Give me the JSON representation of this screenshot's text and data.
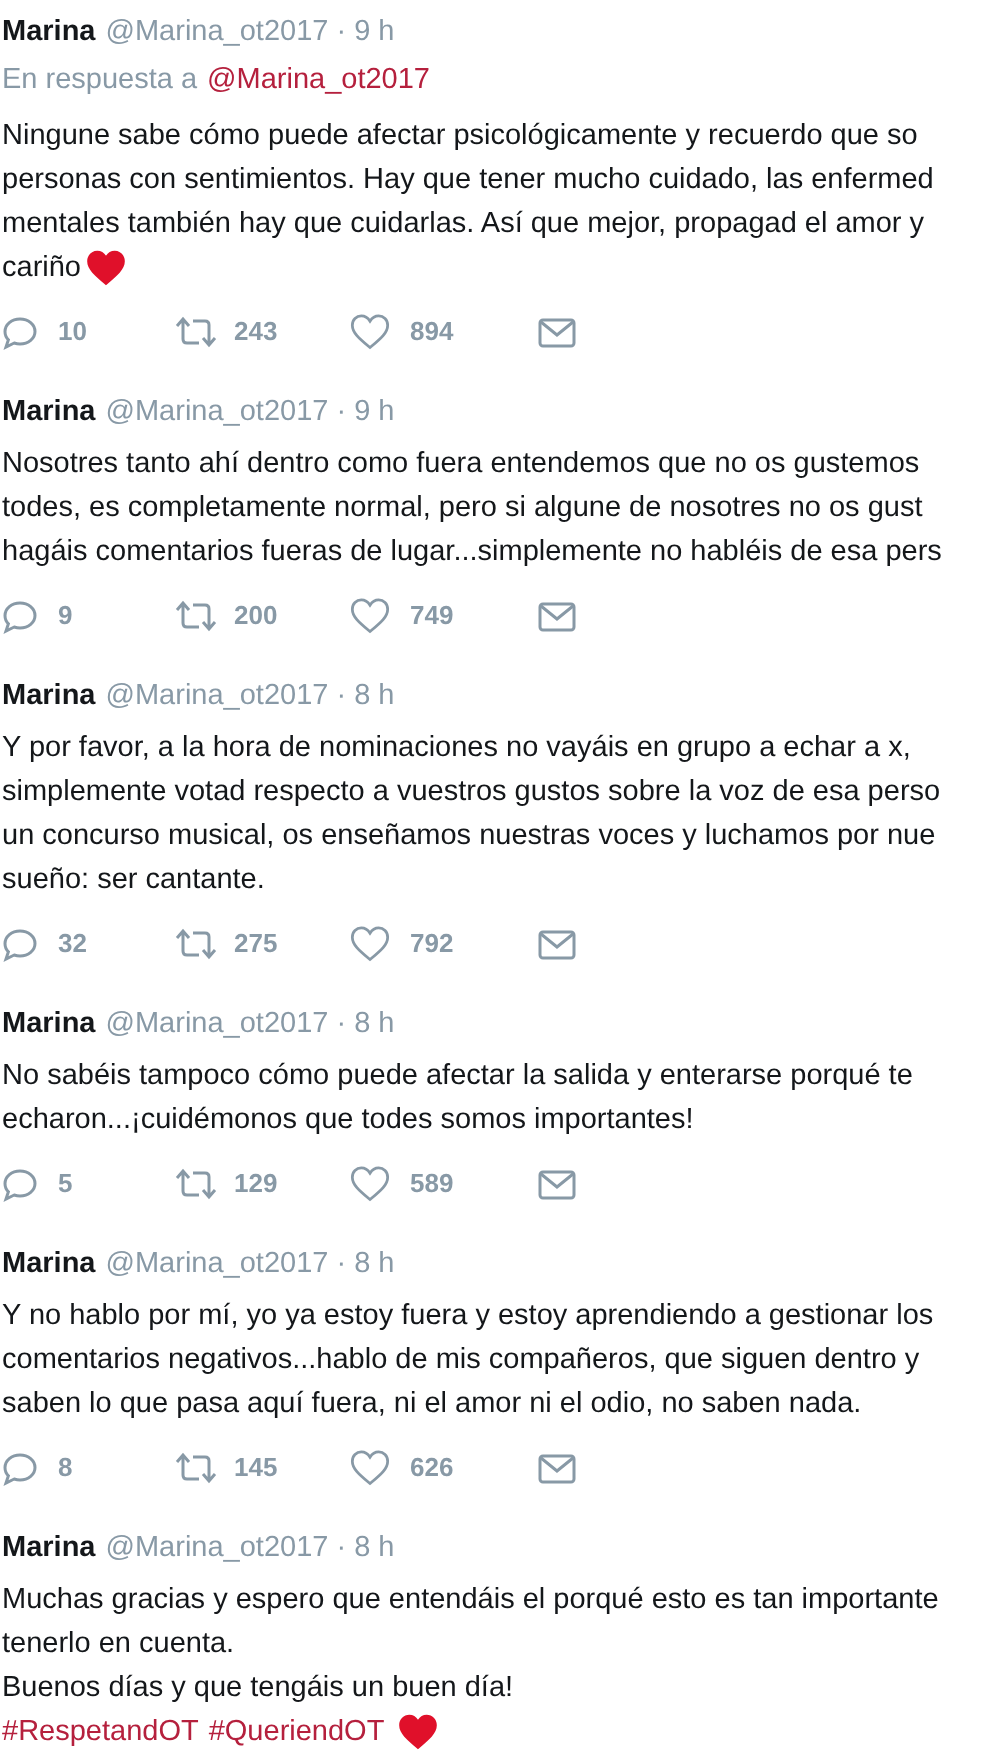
{
  "tweets": [
    {
      "name": "Marina",
      "meta": "@Marina_ot2017 · 9 h",
      "reply_to": {
        "label": "En respuesta a",
        "handle": "@Marina_ot2017"
      },
      "lines": [
        {
          "kind": "text",
          "text": "Ningune sabe cómo puede afectar psicológicamente y recuerdo que so"
        },
        {
          "kind": "text",
          "text": "personas con sentimientos. Hay que tener mucho cuidado, las enfermed"
        },
        {
          "kind": "text",
          "text": "mentales también hay que cuidarlas. Así que mejor, propagad el amor y"
        },
        {
          "kind": "text",
          "text": "cariño",
          "heart": true
        }
      ],
      "replies": "10",
      "retweets": "243",
      "likes": "894"
    },
    {
      "name": "Marina",
      "meta": "@Marina_ot2017 · 9 h",
      "lines": [
        {
          "kind": "text",
          "text": "Nosotres tanto ahí dentro como fuera entendemos que no os gustemos"
        },
        {
          "kind": "text",
          "text": "todes, es completamente normal, pero si algune de nosotres no os gust"
        },
        {
          "kind": "text",
          "text": "hagáis comentarios fueras de lugar...simplemente no habléis de esa pers"
        }
      ],
      "replies": "9",
      "retweets": "200",
      "likes": "749"
    },
    {
      "name": "Marina",
      "meta": "@Marina_ot2017 · 8 h",
      "lines": [
        {
          "kind": "text",
          "text": "Y por favor, a la hora de nominaciones no vayáis en grupo a echar a x,"
        },
        {
          "kind": "text",
          "text": "simplemente votad respecto a vuestros gustos sobre la voz de esa perso"
        },
        {
          "kind": "text",
          "text": "un concurso musical, os enseñamos nuestras voces y luchamos por nue"
        },
        {
          "kind": "text",
          "text": "sueño: ser cantante."
        }
      ],
      "replies": "32",
      "retweets": "275",
      "likes": "792"
    },
    {
      "name": "Marina",
      "meta": "@Marina_ot2017 · 8 h",
      "lines": [
        {
          "kind": "text",
          "text": "No sabéis tampoco cómo puede afectar la salida y enterarse porqué te"
        },
        {
          "kind": "text",
          "text": "echaron...¡cuidémonos que todes somos importantes!"
        }
      ],
      "replies": "5",
      "retweets": "129",
      "likes": "589"
    },
    {
      "name": "Marina",
      "meta": "@Marina_ot2017 · 8 h",
      "lines": [
        {
          "kind": "text",
          "text": "Y no hablo por mí, yo ya estoy fuera y estoy aprendiendo a gestionar los"
        },
        {
          "kind": "text",
          "text": "comentarios negativos...hablo de mis compañeros, que siguen dentro y"
        },
        {
          "kind": "text",
          "text": "saben lo que pasa aquí fuera, ni el amor ni el odio, no saben nada."
        }
      ],
      "replies": "8",
      "retweets": "145",
      "likes": "626"
    },
    {
      "name": "Marina",
      "meta": "@Marina_ot2017 · 8 h",
      "lines": [
        {
          "kind": "text",
          "text": "Muchas gracias y espero que entendáis el porqué esto es tan importante"
        },
        {
          "kind": "text",
          "text": "tenerlo en cuenta."
        },
        {
          "kind": "text",
          "text": "Buenos días y que tengáis un buen día!"
        },
        {
          "kind": "hashtags",
          "tags": [
            "#RespetandOT",
            "#QueriendOT"
          ],
          "heart": true
        }
      ]
    }
  ]
}
